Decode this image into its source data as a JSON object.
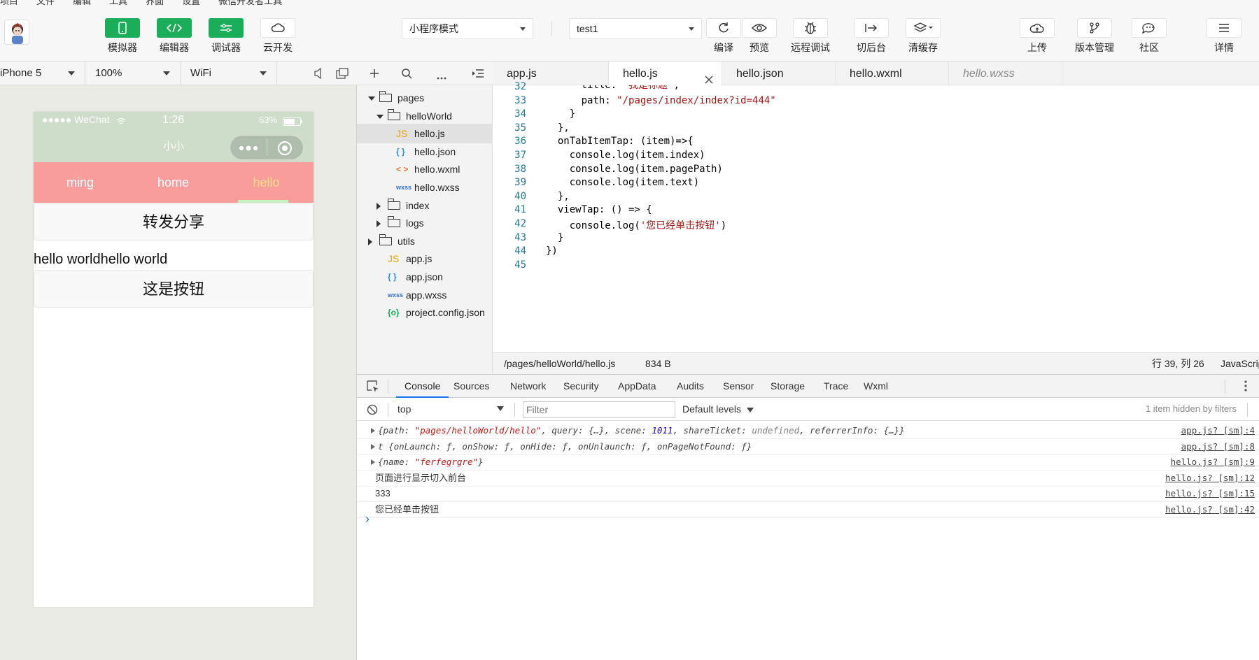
{
  "menubar": {
    "items": [
      "项目",
      "文件",
      "编辑",
      "工具",
      "界面",
      "设置",
      "微信开发者工具"
    ]
  },
  "toolbar": {
    "simulator": "模拟器",
    "editor": "编辑器",
    "debugger": "调试器",
    "cloud": "云开发",
    "mode_select": "小程序模式",
    "compile_select": "test1",
    "compile": "编译",
    "preview": "预览",
    "remote_debug": "远程调试",
    "background": "切后台",
    "clear_cache": "清缓存",
    "upload": "上传",
    "version": "版本管理",
    "community": "社区",
    "details": "详情"
  },
  "simulator": {
    "device": "iPhone 5",
    "zoom": "100%",
    "network": "WiFi",
    "status": {
      "carrier": "●●●●● WeChat",
      "time": "1:26",
      "battery": "63%"
    },
    "nav_title": "小小",
    "tabs": [
      "ming",
      "home",
      "hello"
    ],
    "active_tab": 2,
    "share_button": "转发分享",
    "text": "hello worldhello world",
    "main_button": "这是按钮"
  },
  "tree": {
    "rows": [
      {
        "label": "pages",
        "kind": "folder-open",
        "depth": 0
      },
      {
        "label": "helloWorld",
        "kind": "folder-open",
        "depth": 1
      },
      {
        "label": "hello.js",
        "kind": "js",
        "depth": 2,
        "icon": "JS"
      },
      {
        "label": "hello.json",
        "kind": "json",
        "depth": 2,
        "icon": "{ }"
      },
      {
        "label": "hello.wxml",
        "kind": "wxml",
        "depth": 2,
        "icon": "< >"
      },
      {
        "label": "hello.wxss",
        "kind": "wxss",
        "depth": 2,
        "icon": "wxss"
      },
      {
        "label": "index",
        "kind": "folder",
        "depth": 1
      },
      {
        "label": "logs",
        "kind": "folder",
        "depth": 1
      },
      {
        "label": "utils",
        "kind": "folder",
        "depth": 0
      },
      {
        "label": "app.js",
        "kind": "js",
        "depth": 1,
        "icon": "JS"
      },
      {
        "label": "app.json",
        "kind": "json",
        "depth": 1,
        "icon": "{ }"
      },
      {
        "label": "app.wxss",
        "kind": "wxss",
        "depth": 1,
        "icon": "wxss"
      },
      {
        "label": "project.config.json",
        "kind": "cfg",
        "depth": 1,
        "icon": "{o}"
      }
    ]
  },
  "editor": {
    "tabs": [
      "app.js",
      "hello.js",
      "hello.json",
      "hello.wxml",
      "hello.wxss"
    ],
    "active_tab": 1,
    "lines": [
      {
        "n": "32",
        "text": "      title: '我是标题',",
        "cut": true
      },
      {
        "n": "33",
        "text": "      path: \"/pages/index/index?id=444\""
      },
      {
        "n": "34",
        "text": "    }"
      },
      {
        "n": "35",
        "text": "  },"
      },
      {
        "n": "36",
        "text": "  onTabItemTap: (item)=>{"
      },
      {
        "n": "37",
        "text": "    console.log(item.index)"
      },
      {
        "n": "38",
        "text": "    console.log(item.pagePath)"
      },
      {
        "n": "39",
        "text": "    console.log(item.text)"
      },
      {
        "n": "40",
        "text": "  },"
      },
      {
        "n": "41",
        "text": "  viewTap: () => {"
      },
      {
        "n": "42",
        "text": "    console.log('您已经单击按钮')"
      },
      {
        "n": "43",
        "text": "  }"
      },
      {
        "n": "44",
        "text": "})"
      },
      {
        "n": "45",
        "text": ""
      }
    ],
    "status": {
      "path": "/pages/helloWorld/hello.js",
      "size": "834 B",
      "cursor": "行 39, 列 26",
      "lang": "JavaScript"
    }
  },
  "devtools": {
    "tabs": [
      "Console",
      "Sources",
      "Network",
      "Security",
      "AppData",
      "Audits",
      "Sensor",
      "Storage",
      "Trace",
      "Wxml"
    ],
    "active_tab": 0,
    "context": "top",
    "filter_placeholder": "Filter",
    "levels": "Default levels",
    "hidden": "1 item hidden by filters",
    "logs": [
      {
        "msg": "{path: \"pages/helloWorld/hello\", query: {…}, scene: 1011, shareTicket: undefined, referrerInfo: {…}}",
        "src": "app.js? [sm]:4",
        "obj": true
      },
      {
        "msg": "t {onLaunch: ƒ, onShow: ƒ, onHide: ƒ, onUnlaunch: ƒ, onPageNotFound: ƒ}",
        "src": "app.js? [sm]:8",
        "obj": true
      },
      {
        "msg": "{name: \"ferfegrgre\"}",
        "src": "hello.js? [sm]:9",
        "obj": true
      },
      {
        "msg": "页面进行显示切入前台",
        "src": "hello.js? [sm]:12",
        "obj": false
      },
      {
        "msg": "333",
        "src": "hello.js? [sm]:15",
        "obj": false
      },
      {
        "msg": "您已经单击按钮",
        "src": "hello.js? [sm]:42",
        "obj": false
      }
    ],
    "prompt": "›"
  },
  "colors": {
    "green": "#1aad5a",
    "nav": "#cdddc9",
    "tabbar": "#f89c9c",
    "active_tab_text": "#ffe08a"
  }
}
